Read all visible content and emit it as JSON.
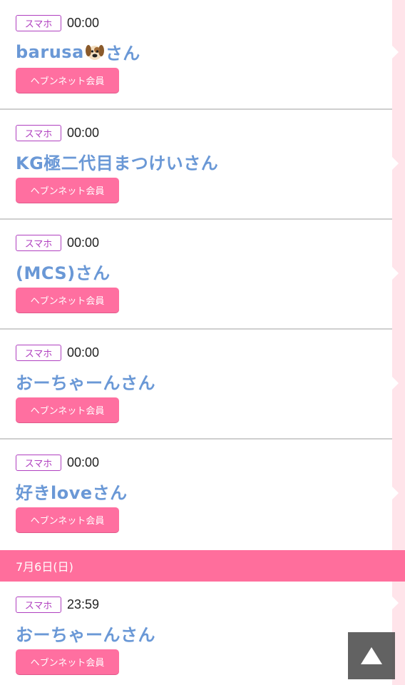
{
  "entries_before": [
    {
      "device": "スマホ",
      "time": "00:00",
      "name_prefix": "barusa",
      "has_dog_emoji": true,
      "name_suffix": "さん",
      "member_label": "ヘブンネット会員"
    },
    {
      "device": "スマホ",
      "time": "00:00",
      "name_prefix": "KG極二代目まつけいさん",
      "has_dog_emoji": false,
      "name_suffix": "",
      "member_label": "ヘブンネット会員"
    },
    {
      "device": "スマホ",
      "time": "00:00",
      "name_prefix": "(MCS)さん",
      "has_dog_emoji": false,
      "name_suffix": "",
      "member_label": "ヘブンネット会員"
    },
    {
      "device": "スマホ",
      "time": "00:00",
      "name_prefix": "おーちゃーんさん",
      "has_dog_emoji": false,
      "name_suffix": "",
      "member_label": "ヘブンネット会員"
    },
    {
      "device": "スマホ",
      "time": "00:00",
      "name_prefix": "好きloveさん",
      "has_dog_emoji": false,
      "name_suffix": "",
      "member_label": "ヘブンネット会員"
    }
  ],
  "date_divider": "7月6日(日)",
  "entries_after": [
    {
      "device": "スマホ",
      "time": "23:59",
      "name_prefix": "おーちゃーんさん",
      "has_dog_emoji": false,
      "name_suffix": "",
      "member_label": "ヘブンネット会員"
    }
  ],
  "icons": {
    "dog": "dog-face-icon",
    "scroll_top": "triangle-up-icon"
  },
  "colors": {
    "badge": "#b040c0",
    "name": "#6a98d6",
    "member_button": "#ff6fa0",
    "date_bar": "#ff6e9c",
    "deco_strip": "#ffe4ea",
    "scroll_button": "#555555"
  }
}
